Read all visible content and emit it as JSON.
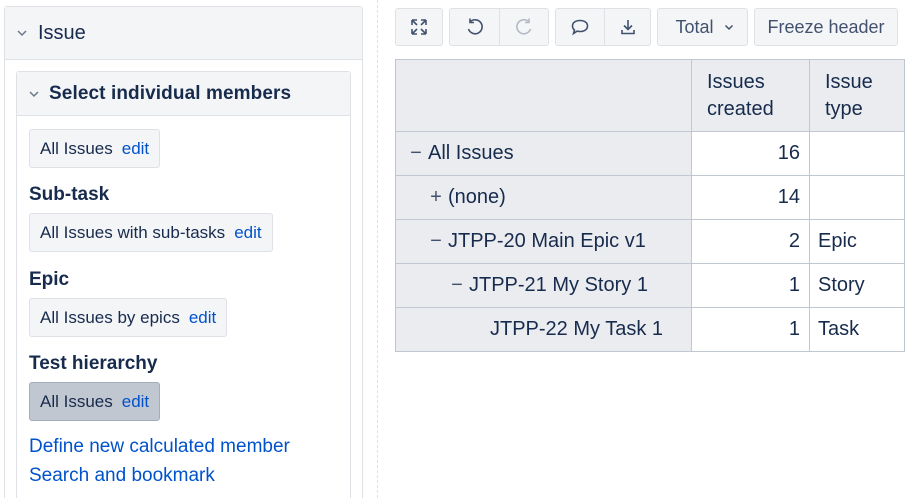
{
  "left_panel": {
    "title": "Issue",
    "sub_panel": {
      "title": "Select individual members",
      "members": [
        {
          "label": "All Issues",
          "edit": "edit"
        }
      ],
      "sections": [
        {
          "label": "Sub-task",
          "chip": {
            "label": "All Issues with sub-tasks",
            "edit": "edit"
          }
        },
        {
          "label": "Epic",
          "chip": {
            "label": "All Issues by epics",
            "edit": "edit"
          }
        },
        {
          "label": "Test hierarchy",
          "chip": {
            "label": "All Issues",
            "edit": "edit",
            "active": true
          }
        }
      ],
      "links": [
        "Define new calculated member",
        "Search and bookmark"
      ]
    }
  },
  "toolbar": {
    "icons": [
      "expand-icon",
      "undo-icon",
      "redo-icon",
      "comment-icon",
      "download-icon"
    ],
    "total_label": "Total",
    "freeze_label": "Freeze header"
  },
  "table": {
    "columns": [
      "Issues created",
      "Issue type"
    ],
    "rows": [
      {
        "label": "All Issues",
        "toggle": "−",
        "indent": 0,
        "issues_created": "16",
        "issue_type": ""
      },
      {
        "label": "(none)",
        "toggle": "+",
        "indent": 1,
        "issues_created": "14",
        "issue_type": ""
      },
      {
        "label": "JTPP-20 Main Epic v1",
        "toggle": "−",
        "indent": 1,
        "issues_created": "2",
        "issue_type": "Epic"
      },
      {
        "label": "JTPP-21 My Story 1",
        "toggle": "−",
        "indent": 2,
        "issues_created": "1",
        "issue_type": "Story"
      },
      {
        "label": "JTPP-22 My Task 1",
        "toggle": "",
        "indent": 3,
        "issues_created": "1",
        "issue_type": "Task"
      }
    ]
  },
  "colors": {
    "link": "#0052cc",
    "text": "#172b4d",
    "panel_bg": "#f4f5f7",
    "header_cell_bg": "#ebecf0",
    "active_chip_bg": "#c1c7d0"
  }
}
